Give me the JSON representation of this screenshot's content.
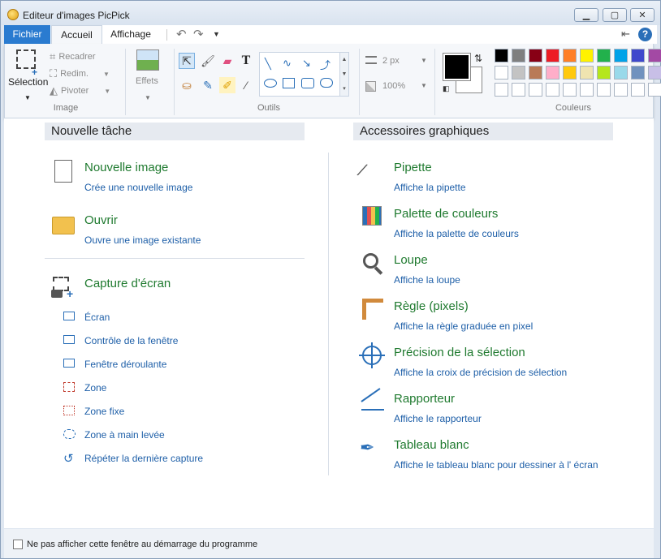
{
  "window": {
    "title": "Editeur d'images PicPick"
  },
  "menu": {
    "file": "Fichier",
    "home": "Accueil",
    "view": "Affichage"
  },
  "ribbon": {
    "selection_label": "Sélection",
    "crop_label": "Recadrer",
    "resize_label": "Redim.",
    "rotate_label": "Pivoter",
    "image_group": "Image",
    "effects_label": "Effets",
    "tools_group": "Outils",
    "stroke_width": "2 px",
    "zoom": "100%",
    "colors_group": "Couleurs"
  },
  "palette": {
    "row1": [
      "#000000",
      "#7f7f7f",
      "#880015",
      "#ed1c24",
      "#ff7f27",
      "#fff200",
      "#22b14c",
      "#00a2e8",
      "#3f48cc",
      "#a349a4"
    ],
    "row2": [
      "#ffffff",
      "#c3c3c3",
      "#b97a57",
      "#ffaec9",
      "#ffc90e",
      "#efe4b0",
      "#b5e61d",
      "#99d9ea",
      "#7092be",
      "#c8bfe7"
    ]
  },
  "left": {
    "heading": "Nouvelle tâche",
    "new_title": "Nouvelle image",
    "new_sub": "Crée une nouvelle image",
    "open_title": "Ouvrir",
    "open_sub": "Ouvre une image existante",
    "capture_title": "Capture d'écran",
    "capture_items": [
      "Écran",
      "Contrôle de la fenêtre",
      "Fenêtre déroulante",
      "Zone",
      "Zone fixe",
      "Zone à main levée",
      "Répéter la dernière capture"
    ]
  },
  "right": {
    "heading": "Accessoires graphiques",
    "items": [
      {
        "title": "Pipette",
        "sub": "Affiche la pipette"
      },
      {
        "title": "Palette de couleurs",
        "sub": "Affiche la palette de couleurs"
      },
      {
        "title": "Loupe",
        "sub": "Affiche la loupe"
      },
      {
        "title": "Règle (pixels)",
        "sub": "Affiche la règle graduée en pixel"
      },
      {
        "title": "Précision de la sélection",
        "sub": "Affiche la croix de précision de sélection"
      },
      {
        "title": "Rapporteur",
        "sub": "Affiche le rapporteur"
      },
      {
        "title": "Tableau blanc",
        "sub": "Affiche le tableau blanc pour dessiner à l' écran"
      }
    ]
  },
  "footer": {
    "checkbox_label": "Ne pas afficher cette fenêtre au démarrage du programme"
  }
}
